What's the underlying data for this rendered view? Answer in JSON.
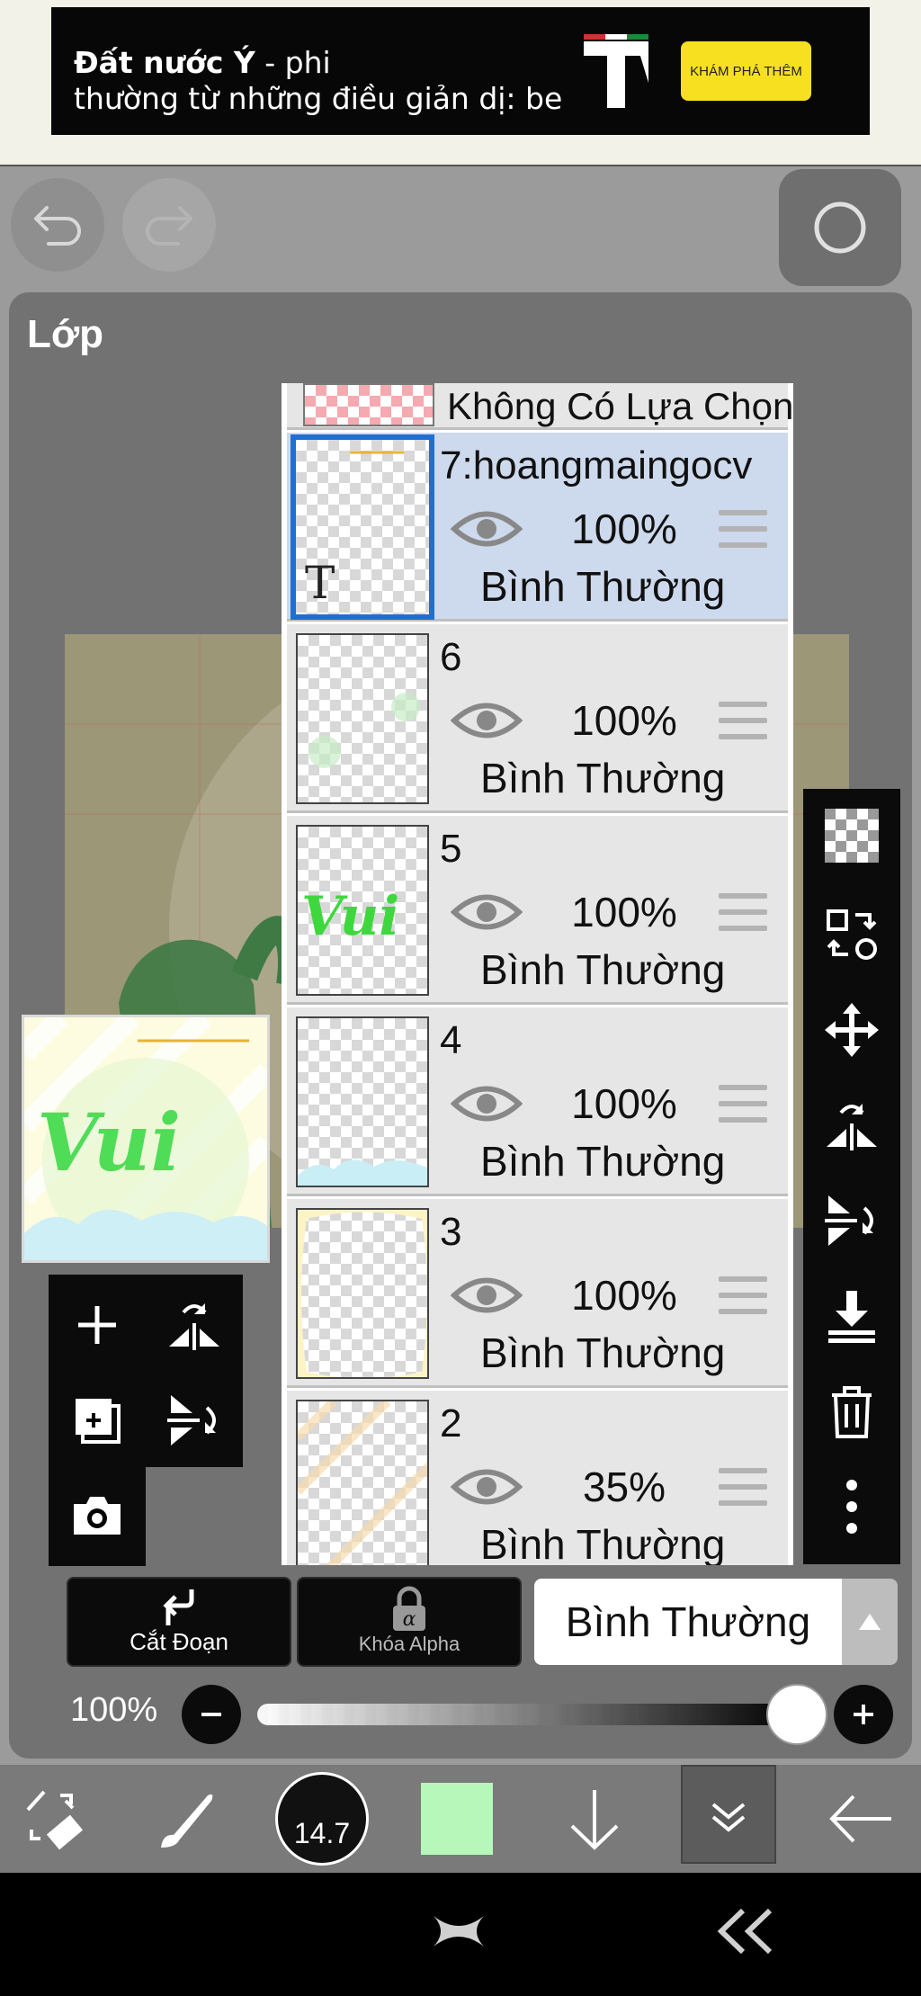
{
  "ad": {
    "title_bold": "Đất nước Ý",
    "title_rest": " - phi",
    "line2": "thường từ những điều giản dị: be",
    "cta": "KHÁM PHÁ THÊM"
  },
  "panel": {
    "title": "Lớp"
  },
  "layers": {
    "selection_label": "Không Có Lựa Chọn",
    "items": [
      {
        "name": "7:hoangmaingocv",
        "opacity": "100%",
        "blend": "Bình Thường"
      },
      {
        "name": "6",
        "opacity": "100%",
        "blend": "Bình Thường"
      },
      {
        "name": "5",
        "opacity": "100%",
        "blend": "Bình Thường"
      },
      {
        "name": "4",
        "opacity": "100%",
        "blend": "Bình Thường"
      },
      {
        "name": "3",
        "opacity": "100%",
        "blend": "Bình Thường"
      },
      {
        "name": "2",
        "opacity": "35%",
        "blend": "Bình Thường"
      }
    ],
    "text_layer_glyph": "T"
  },
  "actions": {
    "clip_label": "Cắt Đoạn",
    "alpha_lock_label": "Khóa Alpha",
    "blend_mode": "Bình Thường"
  },
  "opacity": {
    "label": "100%",
    "value": 1.0
  },
  "toolbar": {
    "brush_size": "14.7",
    "color": "#b7f7b9"
  },
  "artwork": {
    "word": "Vui"
  },
  "colors": {
    "selected_layer": "#cdd9ec",
    "selected_border": "#1f6fd1",
    "ad_cta": "#f7e01f"
  }
}
